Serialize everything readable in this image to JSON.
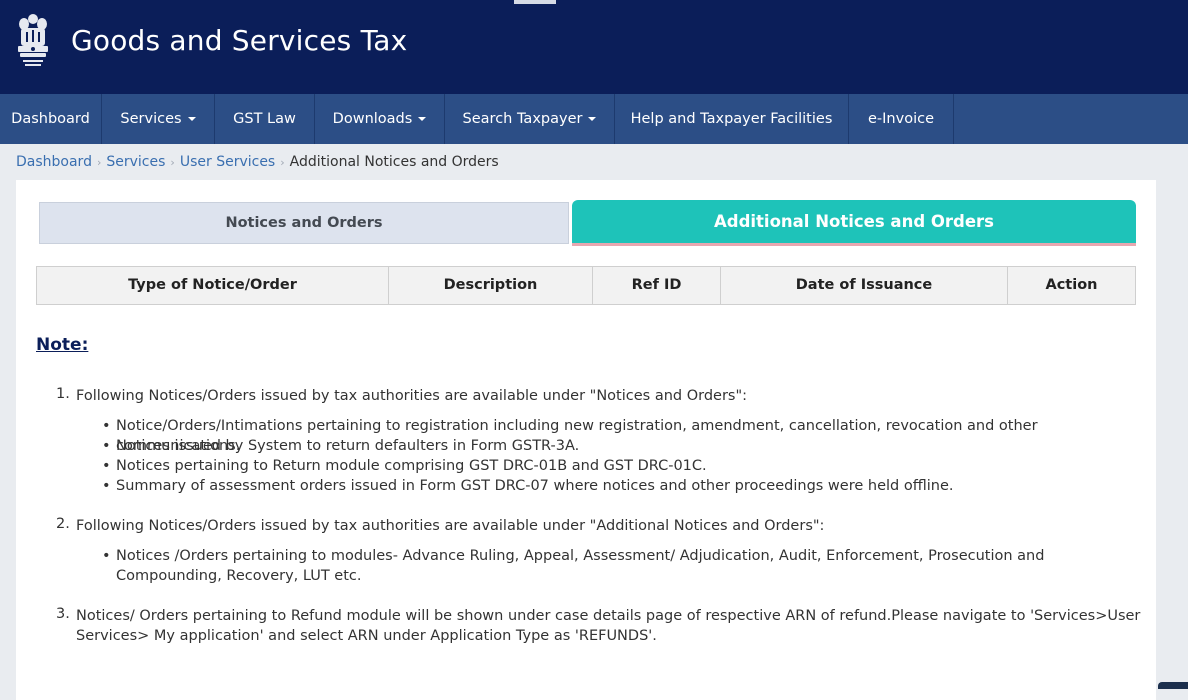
{
  "header": {
    "title": "Goods and Services Tax",
    "emblem_icon": "national-emblem-icon"
  },
  "nav": [
    {
      "label": "Dashboard",
      "dropdown": false
    },
    {
      "label": "Services",
      "dropdown": true
    },
    {
      "label": "GST Law",
      "dropdown": false
    },
    {
      "label": "Downloads",
      "dropdown": true
    },
    {
      "label": "Search Taxpayer",
      "dropdown": true
    },
    {
      "label": "Help and Taxpayer Facilities",
      "dropdown": false
    },
    {
      "label": "e-Invoice",
      "dropdown": false
    }
  ],
  "breadcrumb": {
    "items": [
      "Dashboard",
      "Services",
      "User Services"
    ],
    "current": "Additional Notices and Orders"
  },
  "tabs": {
    "left": "Notices and Orders",
    "right": "Additional Notices and Orders"
  },
  "table": {
    "headers": [
      "Type of Notice/Order",
      "Description",
      "Ref ID",
      "Date of Issuance",
      "Action"
    ]
  },
  "note": {
    "title": "Note:",
    "items": [
      {
        "num": "1.",
        "text": "Following Notices/Orders issued by tax authorities are available under \"Notices and Orders\":",
        "bullets": [
          "Notice/Orders/Intimations pertaining to registration including new registration, amendment, cancellation, revocation and other communications.",
          "Notices issued by System to return defaulters in Form GSTR-3A.",
          "Notices pertaining to Return module comprising GST DRC-01B and GST DRC-01C.",
          "Summary of assessment orders issued in Form GST DRC-07 where notices and other proceedings were held offline."
        ]
      },
      {
        "num": "2.",
        "text": "Following Notices/Orders issued by tax authorities are available under \"Additional Notices and Orders\":",
        "bullets": [
          "Notices /Orders pertaining to modules- Advance Ruling, Appeal, Assessment/ Adjudication, Audit, Enforcement, Prosecution and Compounding, Recovery, LUT etc."
        ]
      },
      {
        "num": "3.",
        "text": "Notices/ Orders pertaining to Refund module will be shown under case details page of respective ARN of refund.Please navigate to 'Services>User Services> My application' and select ARN under Application Type as 'REFUNDS'.",
        "bullets": []
      }
    ]
  },
  "colors": {
    "header_bg": "#0b1e59",
    "nav_bg": "#2c4e86",
    "active_tab": "#1ec3b9",
    "inactive_tab": "#dde3ee",
    "link": "#3a6fb0"
  }
}
